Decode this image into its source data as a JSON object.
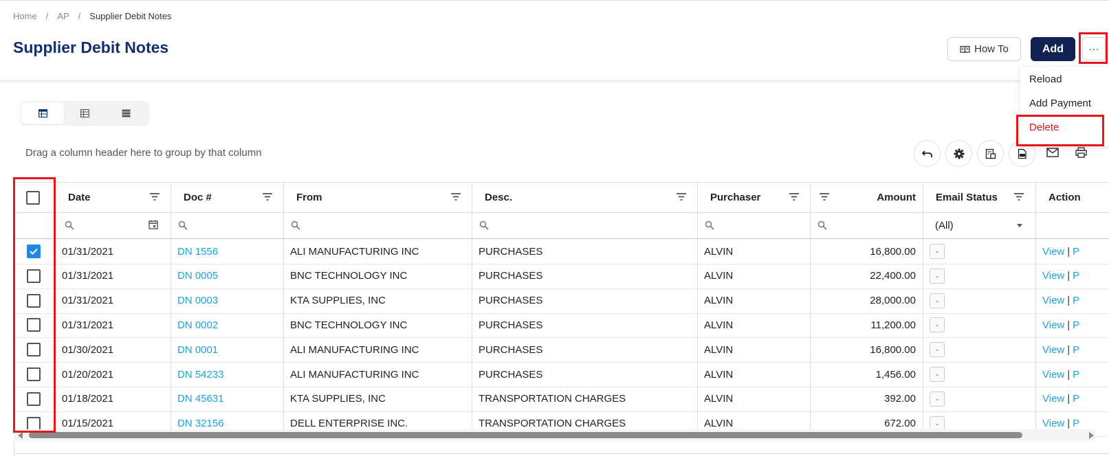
{
  "breadcrumb": {
    "home": "Home",
    "ap": "AP",
    "current": "Supplier Debit Notes",
    "separator": "/"
  },
  "page": {
    "title": "Supplier Debit Notes"
  },
  "actions": {
    "how_to": "How To",
    "add": "Add",
    "more": "···"
  },
  "more_menu": {
    "items": [
      "Reload",
      "Add Payment",
      "Delete"
    ]
  },
  "grid": {
    "group_hint": "Drag a column header here to group by that column",
    "columns": [
      "Date",
      "Doc #",
      "From",
      "Desc.",
      "Purchaser",
      "Amount",
      "Email Status",
      "Action"
    ],
    "email_status_filter": "(All)",
    "rows": [
      {
        "checked": true,
        "date": "01/31/2021",
        "doc": "DN 1556",
        "from": "ALI MANUFACTURING INC",
        "desc": "PURCHASES",
        "purchaser": "ALVIN",
        "amount": "16,800.00",
        "email_status": "-"
      },
      {
        "checked": false,
        "date": "01/31/2021",
        "doc": "DN 0005",
        "from": "BNC TECHNOLOGY INC",
        "desc": "PURCHASES",
        "purchaser": "ALVIN",
        "amount": "22,400.00",
        "email_status": "-"
      },
      {
        "checked": false,
        "date": "01/31/2021",
        "doc": "DN 0003",
        "from": "KTA SUPPLIES, INC",
        "desc": "PURCHASES",
        "purchaser": "ALVIN",
        "amount": "28,000.00",
        "email_status": "-"
      },
      {
        "checked": false,
        "date": "01/31/2021",
        "doc": "DN 0002",
        "from": "BNC TECHNOLOGY INC",
        "desc": "PURCHASES",
        "purchaser": "ALVIN",
        "amount": "11,200.00",
        "email_status": "-"
      },
      {
        "checked": false,
        "date": "01/30/2021",
        "doc": "DN 0001",
        "from": "ALI MANUFACTURING INC",
        "desc": "PURCHASES",
        "purchaser": "ALVIN",
        "amount": "16,800.00",
        "email_status": "-"
      },
      {
        "checked": false,
        "date": "01/20/2021",
        "doc": "DN 54233",
        "from": "ALI MANUFACTURING INC",
        "desc": "PURCHASES",
        "purchaser": "ALVIN",
        "amount": "1,456.00",
        "email_status": "-"
      },
      {
        "checked": false,
        "date": "01/18/2021",
        "doc": "DN 45631",
        "from": "KTA SUPPLIES, INC",
        "desc": "TRANSPORTATION CHARGES",
        "purchaser": "ALVIN",
        "amount": "392.00",
        "email_status": "-"
      },
      {
        "checked": false,
        "date": "01/15/2021",
        "doc": "DN 32156",
        "from": "DELL ENTERPRISE INC.",
        "desc": "TRANSPORTATION CHARGES",
        "purchaser": "ALVIN",
        "amount": "672.00",
        "email_status": "-"
      }
    ],
    "row_actions": {
      "view": "View",
      "separator": "|",
      "second": "P"
    }
  },
  "colors": {
    "title": "#12306b",
    "primary_button": "#0f2250",
    "link": "#1aa3dc",
    "checkbox": "#1e88e5",
    "highlight": "#e4161b"
  },
  "icons": [
    "book-icon",
    "grid-view-icon",
    "table-view-icon",
    "list-view-icon",
    "undo-icon",
    "gear-icon",
    "export-icon",
    "pdf-icon",
    "mail-icon",
    "print-icon",
    "filter-icon",
    "search-icon",
    "calendar-icon",
    "dropdown-icon"
  ]
}
